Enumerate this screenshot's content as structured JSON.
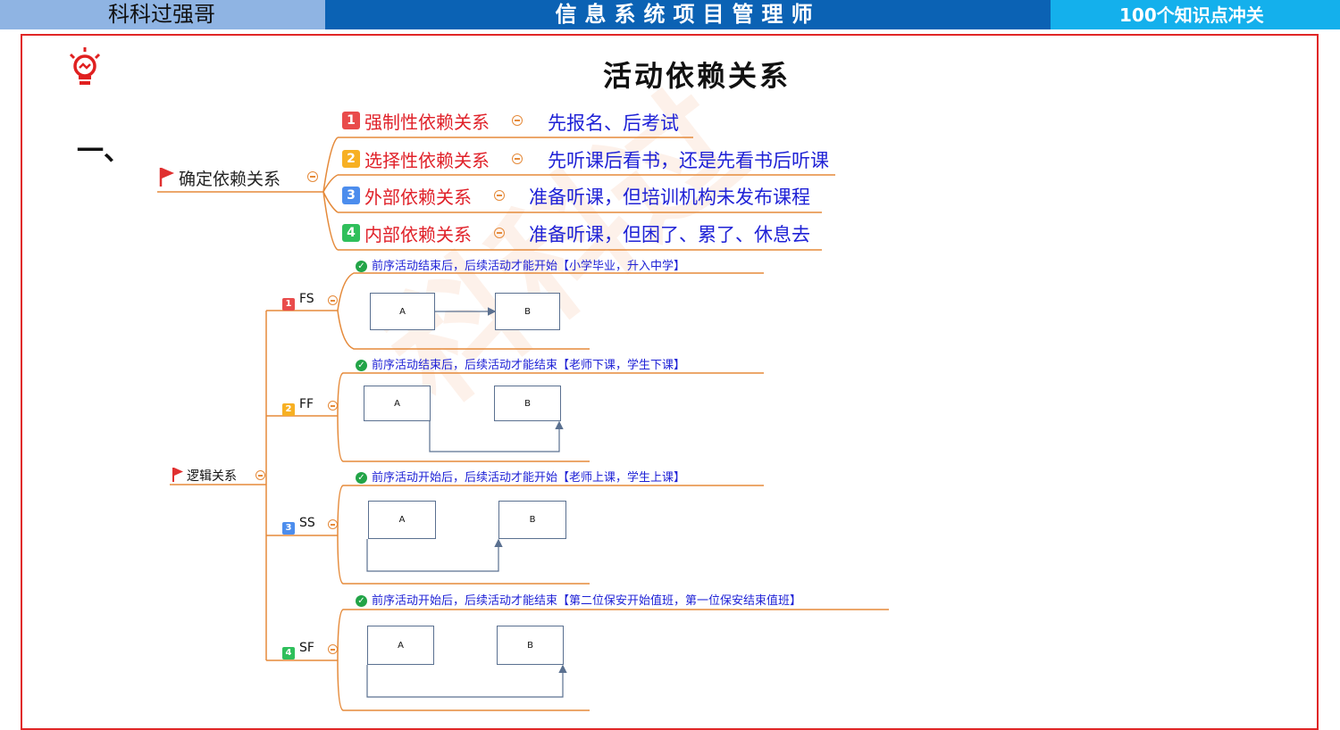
{
  "header": {
    "left_title": "科科过强哥",
    "center_title": "信息系统项目管理师",
    "right_title": "100个知识点冲关"
  },
  "page": {
    "title": "活动依赖关系",
    "section_number": "一、"
  },
  "dependency": {
    "root_label": "确定依赖关系",
    "items": [
      {
        "num": "1",
        "label": "强制性依赖关系",
        "note": "先报名、后考试"
      },
      {
        "num": "2",
        "label": "选择性依赖关系",
        "note": "先听课后看书，还是先看书后听课"
      },
      {
        "num": "3",
        "label": "外部依赖关系",
        "note": "准备听课，但培训机构未发布课程"
      },
      {
        "num": "4",
        "label": "内部依赖关系",
        "note": "准备听课，但困了、累了、休息去"
      }
    ]
  },
  "logic": {
    "root_label": "逻辑关系",
    "items": [
      {
        "num": "1",
        "label": "FS",
        "desc": "前序活动结束后，后续活动才能开始【小学毕业，升入中学】",
        "box_a": "A",
        "box_b": "B"
      },
      {
        "num": "2",
        "label": "FF",
        "desc": "前序活动结束后，后续活动才能结束【老师下课，学生下课】",
        "box_a": "A",
        "box_b": "B"
      },
      {
        "num": "3",
        "label": "SS",
        "desc": "前序活动开始后，后续活动才能开始【老师上课，学生上课】",
        "box_a": "A",
        "box_b": "B"
      },
      {
        "num": "4",
        "label": "SF",
        "desc": "前序活动开始后，后续活动才能结束【第二位保安开始值班，第一位保安结束值班】",
        "box_a": "A",
        "box_b": "B"
      }
    ]
  },
  "watermark": "科科过",
  "colors": {
    "header_left": "#8fb4e3",
    "header_center": "#0b62b4",
    "header_right": "#14b0ec",
    "frame": "#e02626",
    "branch_line": "#e58a3a",
    "label_red": "#e0222a",
    "note_blue": "#1f22d6"
  },
  "icons": [
    "lightbulb-icon",
    "flag-icon",
    "collapse-icon",
    "check-icon"
  ]
}
